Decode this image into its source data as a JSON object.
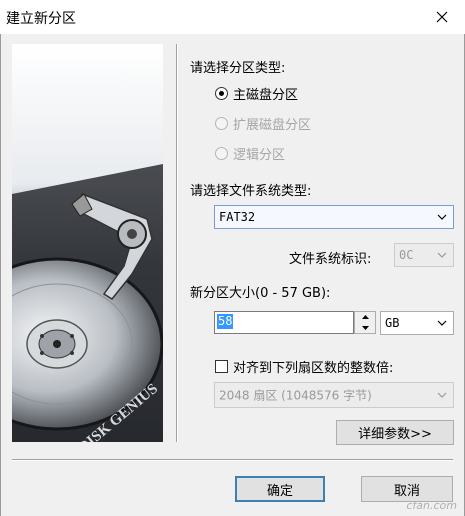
{
  "window": {
    "title": "建立新分区"
  },
  "partition_type": {
    "label": "请选择分区类型:",
    "options": [
      "主磁盘分区",
      "扩展磁盘分区",
      "逻辑分区"
    ],
    "selected": "主磁盘分区"
  },
  "filesystem": {
    "label": "请选择文件系统类型:",
    "value": "FAT32",
    "id_label": "文件系统标识:",
    "id_value": "0C"
  },
  "size": {
    "label": "新分区大小(0 - 57 GB):",
    "value": "58",
    "unit": "GB"
  },
  "align": {
    "label": "对齐到下列扇区数的整数倍:",
    "value": "2048 扇区 (1048576 字节)"
  },
  "buttons": {
    "details": "详细参数>>",
    "ok": "确定",
    "cancel": "取消"
  },
  "side_image": {
    "brand_text": "DISK GENIUS"
  },
  "watermark": "cfan.com"
}
